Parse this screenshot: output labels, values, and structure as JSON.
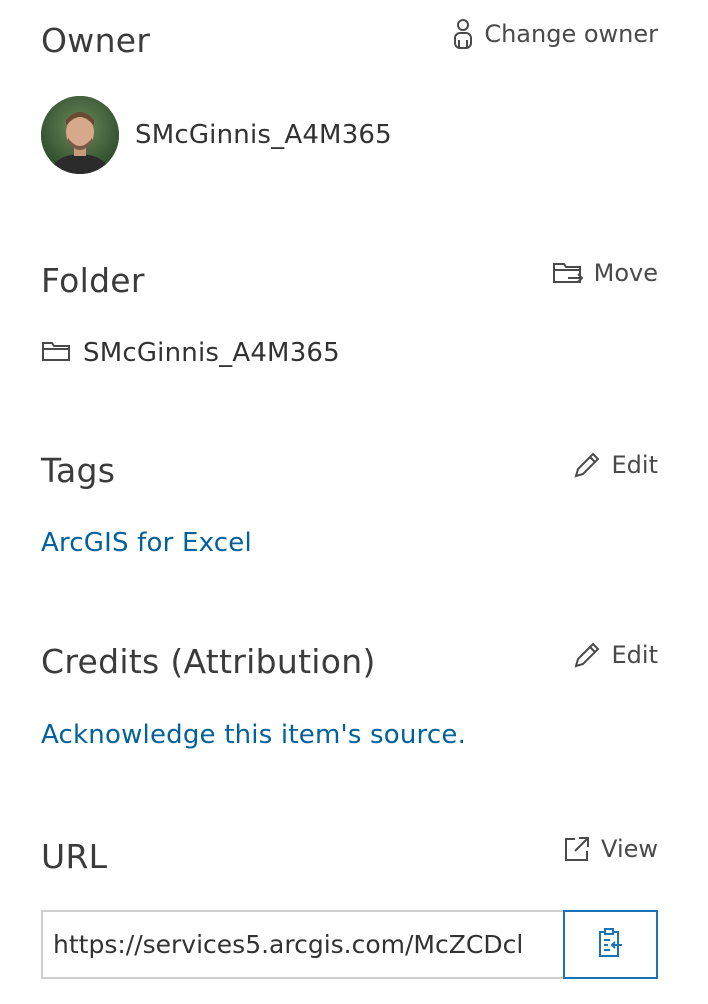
{
  "owner": {
    "title": "Owner",
    "action_label": "Change owner",
    "action_icon": "user-icon",
    "username": "SMcGinnis_A4M365"
  },
  "folder": {
    "title": "Folder",
    "action_label": "Move",
    "action_icon": "folder-move-icon",
    "name": "SMcGinnis_A4M365",
    "folder_icon": "folder-icon"
  },
  "tags": {
    "title": "Tags",
    "action_label": "Edit",
    "action_icon": "pencil-icon",
    "items": [
      "ArcGIS for Excel"
    ]
  },
  "credits": {
    "title": "Credits (Attribution)",
    "action_label": "Edit",
    "action_icon": "pencil-icon",
    "placeholder_link": "Acknowledge this item's source."
  },
  "url": {
    "title": "URL",
    "action_label": "View",
    "action_icon": "external-link-icon",
    "value": "https://services5.arcgis.com/McZCDcl",
    "copy_icon": "copy-clipboard-icon"
  },
  "colors": {
    "link": "#00619b",
    "text": "#323232",
    "copy_border": "#1a73b8"
  }
}
